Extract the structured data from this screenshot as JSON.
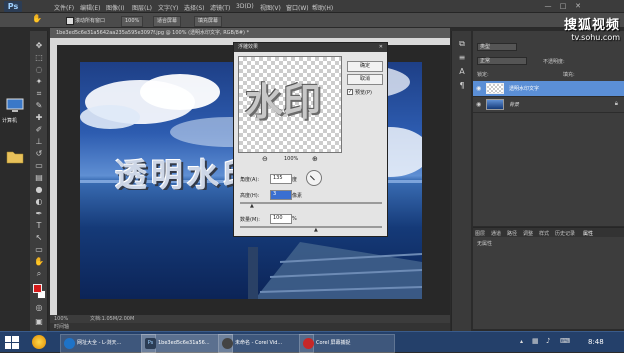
{
  "app": {
    "logo": "Ps"
  },
  "menu": [
    "文件(F)",
    "编辑(E)",
    "图像(I)",
    "图层(L)",
    "文字(Y)",
    "选择(S)",
    "滤镜(T)",
    "3D(D)",
    "视图(V)",
    "窗口(W)",
    "帮助(H)"
  ],
  "window_controls": {
    "minimize": "—",
    "restore": "□",
    "close": "✕"
  },
  "options": {
    "scroll_all_windows": "滚动所有窗口",
    "zoom_value": "100%",
    "fit_screen": "适合屏幕",
    "fill_screen": "填充屏幕"
  },
  "document": {
    "tab_title": "1be3ed5c6e31a5642aa235a595e3097f.jpg @ 100% (透明水印文字, RGB/8#) *",
    "status_zoom": "100%",
    "status_doc": "文档:1.05M/2.00M",
    "timeline_label": "时间轴"
  },
  "canvas_text": "透明水印",
  "dialog": {
    "title": "浮雕效果",
    "ok": "确定",
    "cancel": "取消",
    "preview_label": "预览(P)",
    "preview_checked": true,
    "preview_text": "水印",
    "zoom": "100%",
    "angle_label": "角度(A):",
    "angle_value": "135",
    "angle_unit": "度",
    "height_label": "高度(H):",
    "height_value": "3",
    "height_unit": "像素",
    "amount_label": "数量(M):",
    "amount_value": "100",
    "amount_unit": "%"
  },
  "layers": {
    "kind": "类型",
    "blend_mode": "正常",
    "opacity_label": "不透明度:",
    "lock_label": "锁定:",
    "fill_label": "填充:",
    "items": [
      {
        "name": "透明水印文字",
        "selected": true
      },
      {
        "name": "背景",
        "selected": false
      }
    ]
  },
  "properties": {
    "tabs": [
      "图层",
      "通道",
      "路径",
      "调整",
      "样式",
      "历史记录",
      "属性"
    ],
    "content": "无属性"
  },
  "desktop": {
    "icon_labels": [
      "",
      "计算机"
    ]
  },
  "watermark": {
    "brand": "搜狐视频",
    "url": "tv.sohu.com"
  },
  "taskbar": {
    "items": [
      "网址大全 - L-浏天...",
      "1be3ed5c6e31a56...",
      "未命名 - Corel Vid...",
      "Corel 屏幕捕捉"
    ],
    "time": "8:48",
    "colors": {
      "ie": "#1e73c8",
      "ps": "#2c3d55",
      "corel_video": "#444444",
      "corel_capture": "#c62828",
      "start": "#ffffff"
    }
  },
  "colors": {
    "foreground": "#d61a1a",
    "background": "#ffffff",
    "accent": "#5b8fd6"
  }
}
